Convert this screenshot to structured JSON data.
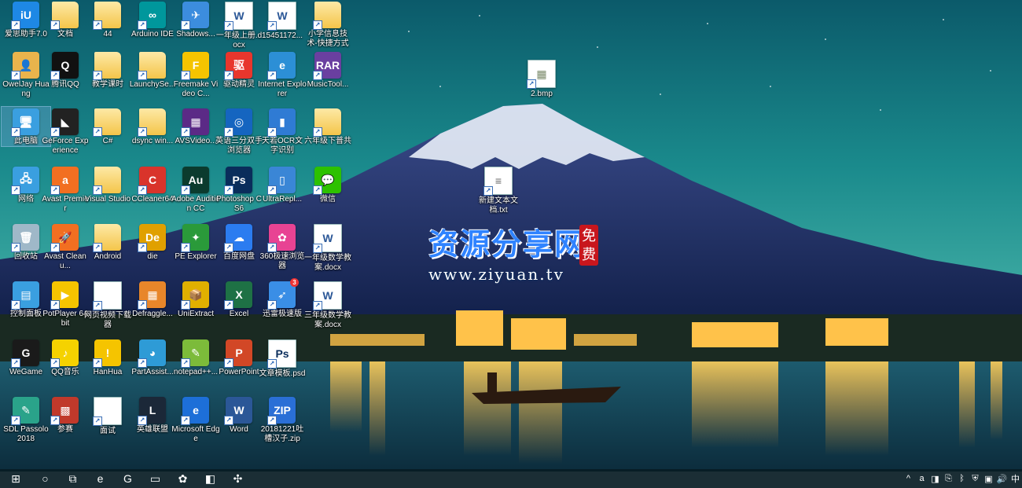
{
  "desktop": {
    "icons": [
      {
        "label": "爱思助手7.0",
        "style": "app",
        "glyph": "iU",
        "color": "#1e88e5",
        "icon": "aisi-icon"
      },
      {
        "label": "文档",
        "style": "folder",
        "glyph": "",
        "color": "#f4c54a",
        "icon": "folder-icon"
      },
      {
        "label": "44",
        "style": "folder",
        "glyph": "",
        "color": "#f4c54a",
        "icon": "folder-icon"
      },
      {
        "label": "Arduino IDE",
        "style": "app",
        "glyph": "∞",
        "color": "#00979c",
        "icon": "arduino-icon"
      },
      {
        "label": "Shadows...",
        "style": "app",
        "glyph": "✈",
        "color": "#3c8dde",
        "icon": "shadowsocks-icon"
      },
      {
        "label": "一年级上册.docx",
        "style": "doc",
        "glyph": "W",
        "color": "#2b5797",
        "icon": "word-doc-icon"
      },
      {
        "label": "15451172...",
        "style": "doc",
        "glyph": "W",
        "color": "#2b5797",
        "icon": "word-doc-icon"
      },
      {
        "label": "小学信息技术-快捷方式",
        "style": "folder",
        "glyph": "",
        "color": "#f4c54a",
        "icon": "folder-shortcut-icon"
      },
      {
        "label": "OwelJay Huang",
        "style": "app",
        "glyph": "👤",
        "color": "#e9b44c",
        "icon": "user-folder-icon"
      },
      {
        "label": "腾讯QQ",
        "style": "app",
        "glyph": "Q",
        "color": "#111111",
        "icon": "qq-icon"
      },
      {
        "label": "教学课时",
        "style": "folder",
        "glyph": "",
        "color": "#f4c54a",
        "icon": "folder-icon"
      },
      {
        "label": "LaunchySe...",
        "style": "folder",
        "glyph": "",
        "color": "#f4c54a",
        "icon": "folder-icon"
      },
      {
        "label": "Freemake Video C...",
        "style": "app",
        "glyph": "F",
        "color": "#f5c400",
        "icon": "freemake-icon"
      },
      {
        "label": "驱动精灵",
        "style": "app",
        "glyph": "驱",
        "color": "#e8362d",
        "icon": "driver-genius-icon"
      },
      {
        "label": "Internet Explorer",
        "style": "app",
        "glyph": "e",
        "color": "#2c8fd6",
        "icon": "internet-explorer-icon"
      },
      {
        "label": "MusicTool...",
        "style": "app",
        "glyph": "RAR",
        "color": "#6a3fa0",
        "icon": "rar-icon"
      },
      {
        "label": "此电脑",
        "style": "app",
        "glyph": "🖥",
        "color": "#3a9fe0",
        "icon": "this-pc-icon",
        "selected": true
      },
      {
        "label": "GeForce Experience",
        "style": "app",
        "glyph": "◣",
        "color": "#222222",
        "icon": "geforce-icon"
      },
      {
        "label": "C#",
        "style": "folder",
        "glyph": "",
        "color": "#f4c54a",
        "icon": "folder-icon"
      },
      {
        "label": "dsync win...",
        "style": "folder",
        "glyph": "",
        "color": "#f4c54a",
        "icon": "folder-icon"
      },
      {
        "label": "AVSVideo...",
        "style": "app",
        "glyph": "▦",
        "color": "#5b2a86",
        "icon": "avs-video-icon"
      },
      {
        "label": "英语三分双手浏览器",
        "style": "app",
        "glyph": "◎",
        "color": "#1565c0",
        "icon": "browser-icon"
      },
      {
        "label": "天若OCR文字识别",
        "style": "app",
        "glyph": "▮",
        "color": "#2f7bd4",
        "icon": "ocr-icon"
      },
      {
        "label": "六年级下普共",
        "style": "folder",
        "glyph": "",
        "color": "#f4c54a",
        "icon": "folder-icon"
      },
      {
        "label": "网络",
        "style": "app",
        "glyph": "🖧",
        "color": "#3a9fe0",
        "icon": "network-icon"
      },
      {
        "label": "Avast Premier",
        "style": "app",
        "glyph": "a",
        "color": "#f26f21",
        "icon": "avast-icon"
      },
      {
        "label": "Visual Studio",
        "style": "folder",
        "glyph": "",
        "color": "#f4c54a",
        "icon": "folder-icon"
      },
      {
        "label": "CCleaner64",
        "style": "app",
        "glyph": "C",
        "color": "#d9342b",
        "icon": "ccleaner-icon"
      },
      {
        "label": "Adobe Audition CC",
        "style": "app",
        "glyph": "Au",
        "color": "#0b3b2e",
        "icon": "audition-icon"
      },
      {
        "label": "Photoshop CS6",
        "style": "app",
        "glyph": "Ps",
        "color": "#0a2d5b",
        "icon": "photoshop-icon"
      },
      {
        "label": "UltraRepl...",
        "style": "app",
        "glyph": "▯",
        "color": "#3a86d6",
        "icon": "ultrarepl-icon"
      },
      {
        "label": "微信",
        "style": "app",
        "glyph": "💬",
        "color": "#2dc100",
        "icon": "wechat-icon"
      },
      {
        "label": "回收站",
        "style": "app",
        "glyph": "🗑",
        "color": "#9fb8c8",
        "icon": "recycle-bin-icon"
      },
      {
        "label": "Avast Cleanu...",
        "style": "app",
        "glyph": "🚀",
        "color": "#f26f21",
        "icon": "avast-cleanup-icon"
      },
      {
        "label": "Android",
        "style": "folder",
        "glyph": "",
        "color": "#f4c54a",
        "icon": "folder-icon"
      },
      {
        "label": "die",
        "style": "app",
        "glyph": "De",
        "color": "#e0a000",
        "icon": "die-icon"
      },
      {
        "label": "PE Explorer",
        "style": "app",
        "glyph": "✦",
        "color": "#2a9a3a",
        "icon": "pe-explorer-icon"
      },
      {
        "label": "百度网盘",
        "style": "app",
        "glyph": "☁",
        "color": "#2b7cf0",
        "icon": "baidu-netdisk-icon"
      },
      {
        "label": "360极速浏览器",
        "style": "app",
        "glyph": "✿",
        "color": "#e84393",
        "icon": "360-browser-icon"
      },
      {
        "label": "一年级数学教案.docx",
        "style": "doc",
        "glyph": "W",
        "color": "#2b5797",
        "icon": "word-doc-icon"
      },
      {
        "label": "控制面板",
        "style": "app",
        "glyph": "▤",
        "color": "#3a9fe0",
        "icon": "control-panel-icon"
      },
      {
        "label": "PotPlayer 64 bit",
        "style": "app",
        "glyph": "▶",
        "color": "#f5c400",
        "icon": "potplayer-icon"
      },
      {
        "label": "网页视频下载器",
        "style": "doc",
        "glyph": "",
        "color": "#ffffff",
        "icon": "file-icon"
      },
      {
        "label": "Defraggle...",
        "style": "app",
        "glyph": "▦",
        "color": "#e8862a",
        "icon": "defraggler-icon"
      },
      {
        "label": "UniExtract",
        "style": "app",
        "glyph": "📦",
        "color": "#e0b000",
        "icon": "uniextract-icon"
      },
      {
        "label": "Excel",
        "style": "app",
        "glyph": "X",
        "color": "#1e7145",
        "icon": "excel-icon"
      },
      {
        "label": "迅雷极速版",
        "style": "app",
        "glyph": "➶",
        "color": "#3a8ee6",
        "icon": "xunlei-icon",
        "badge": "3"
      },
      {
        "label": "三年级数学教案.docx",
        "style": "doc",
        "glyph": "W",
        "color": "#2b5797",
        "icon": "word-doc-icon"
      },
      {
        "label": "WeGame",
        "style": "app",
        "glyph": "G",
        "color": "#1a1a1a",
        "icon": "wegame-icon"
      },
      {
        "label": "QQ音乐",
        "style": "app",
        "glyph": "♪",
        "color": "#f5d200",
        "icon": "qq-music-icon"
      },
      {
        "label": "HanHua",
        "style": "app",
        "glyph": "!",
        "color": "#f5c400",
        "icon": "warning-icon"
      },
      {
        "label": "PartAssist...",
        "style": "app",
        "glyph": "◕",
        "color": "#2e9bd6",
        "icon": "partassist-icon"
      },
      {
        "label": "notepad++...",
        "style": "app",
        "glyph": "✎",
        "color": "#7cbb3a",
        "icon": "notepadpp-icon"
      },
      {
        "label": "PowerPoint",
        "style": "app",
        "glyph": "P",
        "color": "#d24726",
        "icon": "powerpoint-icon"
      },
      {
        "label": "文章模板.psd",
        "style": "doc",
        "glyph": "Ps",
        "color": "#0a2d5b",
        "icon": "psd-file-icon"
      },
      {
        "label": "SDL Passolo 2018",
        "style": "app",
        "glyph": "✎",
        "color": "#2aa38a",
        "icon": "passolo-icon"
      },
      {
        "label": "参赛",
        "style": "app",
        "glyph": "▩",
        "color": "#c0392b",
        "icon": "folder-image-icon"
      },
      {
        "label": "面试",
        "style": "doc",
        "glyph": "",
        "color": "#ffffff",
        "icon": "file-icon"
      },
      {
        "label": "英雄联盟",
        "style": "app",
        "glyph": "L",
        "color": "#1b2838",
        "icon": "lol-icon"
      },
      {
        "label": "Microsoft Edge",
        "style": "app",
        "glyph": "e",
        "color": "#1d6fd8",
        "icon": "edge-icon"
      },
      {
        "label": "Word",
        "style": "app",
        "glyph": "W",
        "color": "#2b5797",
        "icon": "word-icon"
      },
      {
        "label": "20181221吐槽汉子.zip",
        "style": "app",
        "glyph": "ZIP",
        "color": "#2a6fd6",
        "icon": "zip-icon"
      }
    ],
    "extra_icons": [
      {
        "label": "2.bmp",
        "style": "doc",
        "glyph": "▦",
        "color": "#7a8a6a",
        "icon": "bitmap-icon"
      },
      {
        "label": "新建文本文档.txt",
        "style": "doc",
        "glyph": "≡",
        "color": "#666666",
        "icon": "text-file-icon"
      }
    ]
  },
  "watermark": {
    "main": "资源分享网",
    "url": "www.ziyuan.tv",
    "free": "免费"
  },
  "taskbar": {
    "items": [
      {
        "icon": "windows-start-icon",
        "glyph": "⊞"
      },
      {
        "icon": "cortana-icon",
        "glyph": "○"
      },
      {
        "icon": "task-view-icon",
        "glyph": "⧉"
      },
      {
        "icon": "edge-icon",
        "glyph": "e"
      },
      {
        "icon": "gomplayer-icon",
        "glyph": "G"
      },
      {
        "icon": "file-explorer-icon",
        "glyph": "▭"
      },
      {
        "icon": "360-browser-icon",
        "glyph": "✿"
      },
      {
        "icon": "app-icon",
        "glyph": "◧"
      },
      {
        "icon": "cleaner-icon",
        "glyph": "✣"
      }
    ],
    "tray": [
      {
        "icon": "chevron-up-icon",
        "glyph": "^"
      },
      {
        "icon": "avast-tray-icon",
        "glyph": "a"
      },
      {
        "icon": "avast-cleanup-tray-icon",
        "glyph": "◨"
      },
      {
        "icon": "usb-icon",
        "glyph": "⎘"
      },
      {
        "icon": "bluetooth-icon",
        "glyph": "ᛒ"
      },
      {
        "icon": "security-icon",
        "glyph": "⛨"
      },
      {
        "icon": "network-tray-icon",
        "glyph": "▣"
      },
      {
        "icon": "volume-icon",
        "glyph": "🔊"
      },
      {
        "icon": "ime-icon",
        "glyph": "中"
      }
    ]
  }
}
